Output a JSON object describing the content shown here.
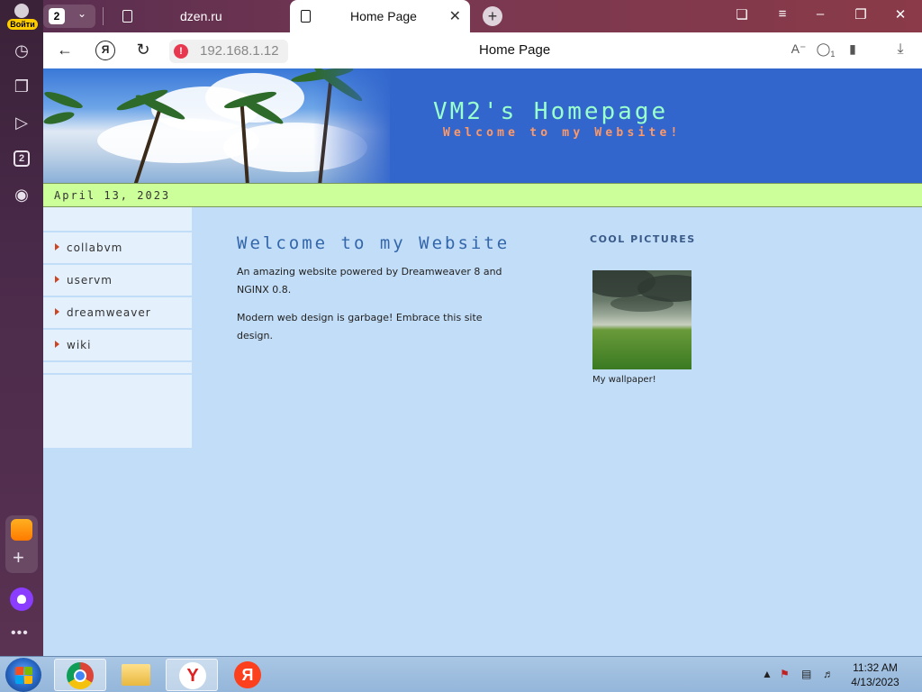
{
  "browser": {
    "login_label": "Войти",
    "tab_count": "2",
    "sidebar_tab_count": "2",
    "tabs": [
      {
        "title": "dzen.ru"
      },
      {
        "title": "Home Page"
      }
    ],
    "url": "192.168.1.12",
    "page_title": "Home Page",
    "extension_badge": "1"
  },
  "site": {
    "title": "VM2's Homepage",
    "subtitle": "Welcome to my Website!",
    "date": "April 13, 2023",
    "nav": [
      {
        "label": "collabvm"
      },
      {
        "label": "uservm"
      },
      {
        "label": "dreamweaver"
      },
      {
        "label": "wiki"
      }
    ],
    "main_heading": "Welcome to my Website",
    "paragraphs": [
      "An amazing website powered by Dreamweaver 8 and NGINX 0.8.",
      "Modern web design is garbage! Embrace this site design."
    ],
    "cool_heading": "COOL PICTURES",
    "wallpaper_caption": "My wallpaper!",
    "colors": {
      "header_bg": "#3366cc",
      "title": "#99ffcc",
      "subtitle": "#ff9966",
      "datebar": "#ccff99",
      "page_bg": "#c2ddf7"
    }
  },
  "taskbar": {
    "apps": [
      "chrome-icon",
      "folder-icon",
      "yandex-browser-icon",
      "yandex-icon"
    ],
    "time": "11:32 AM",
    "date": "4/13/2023"
  }
}
